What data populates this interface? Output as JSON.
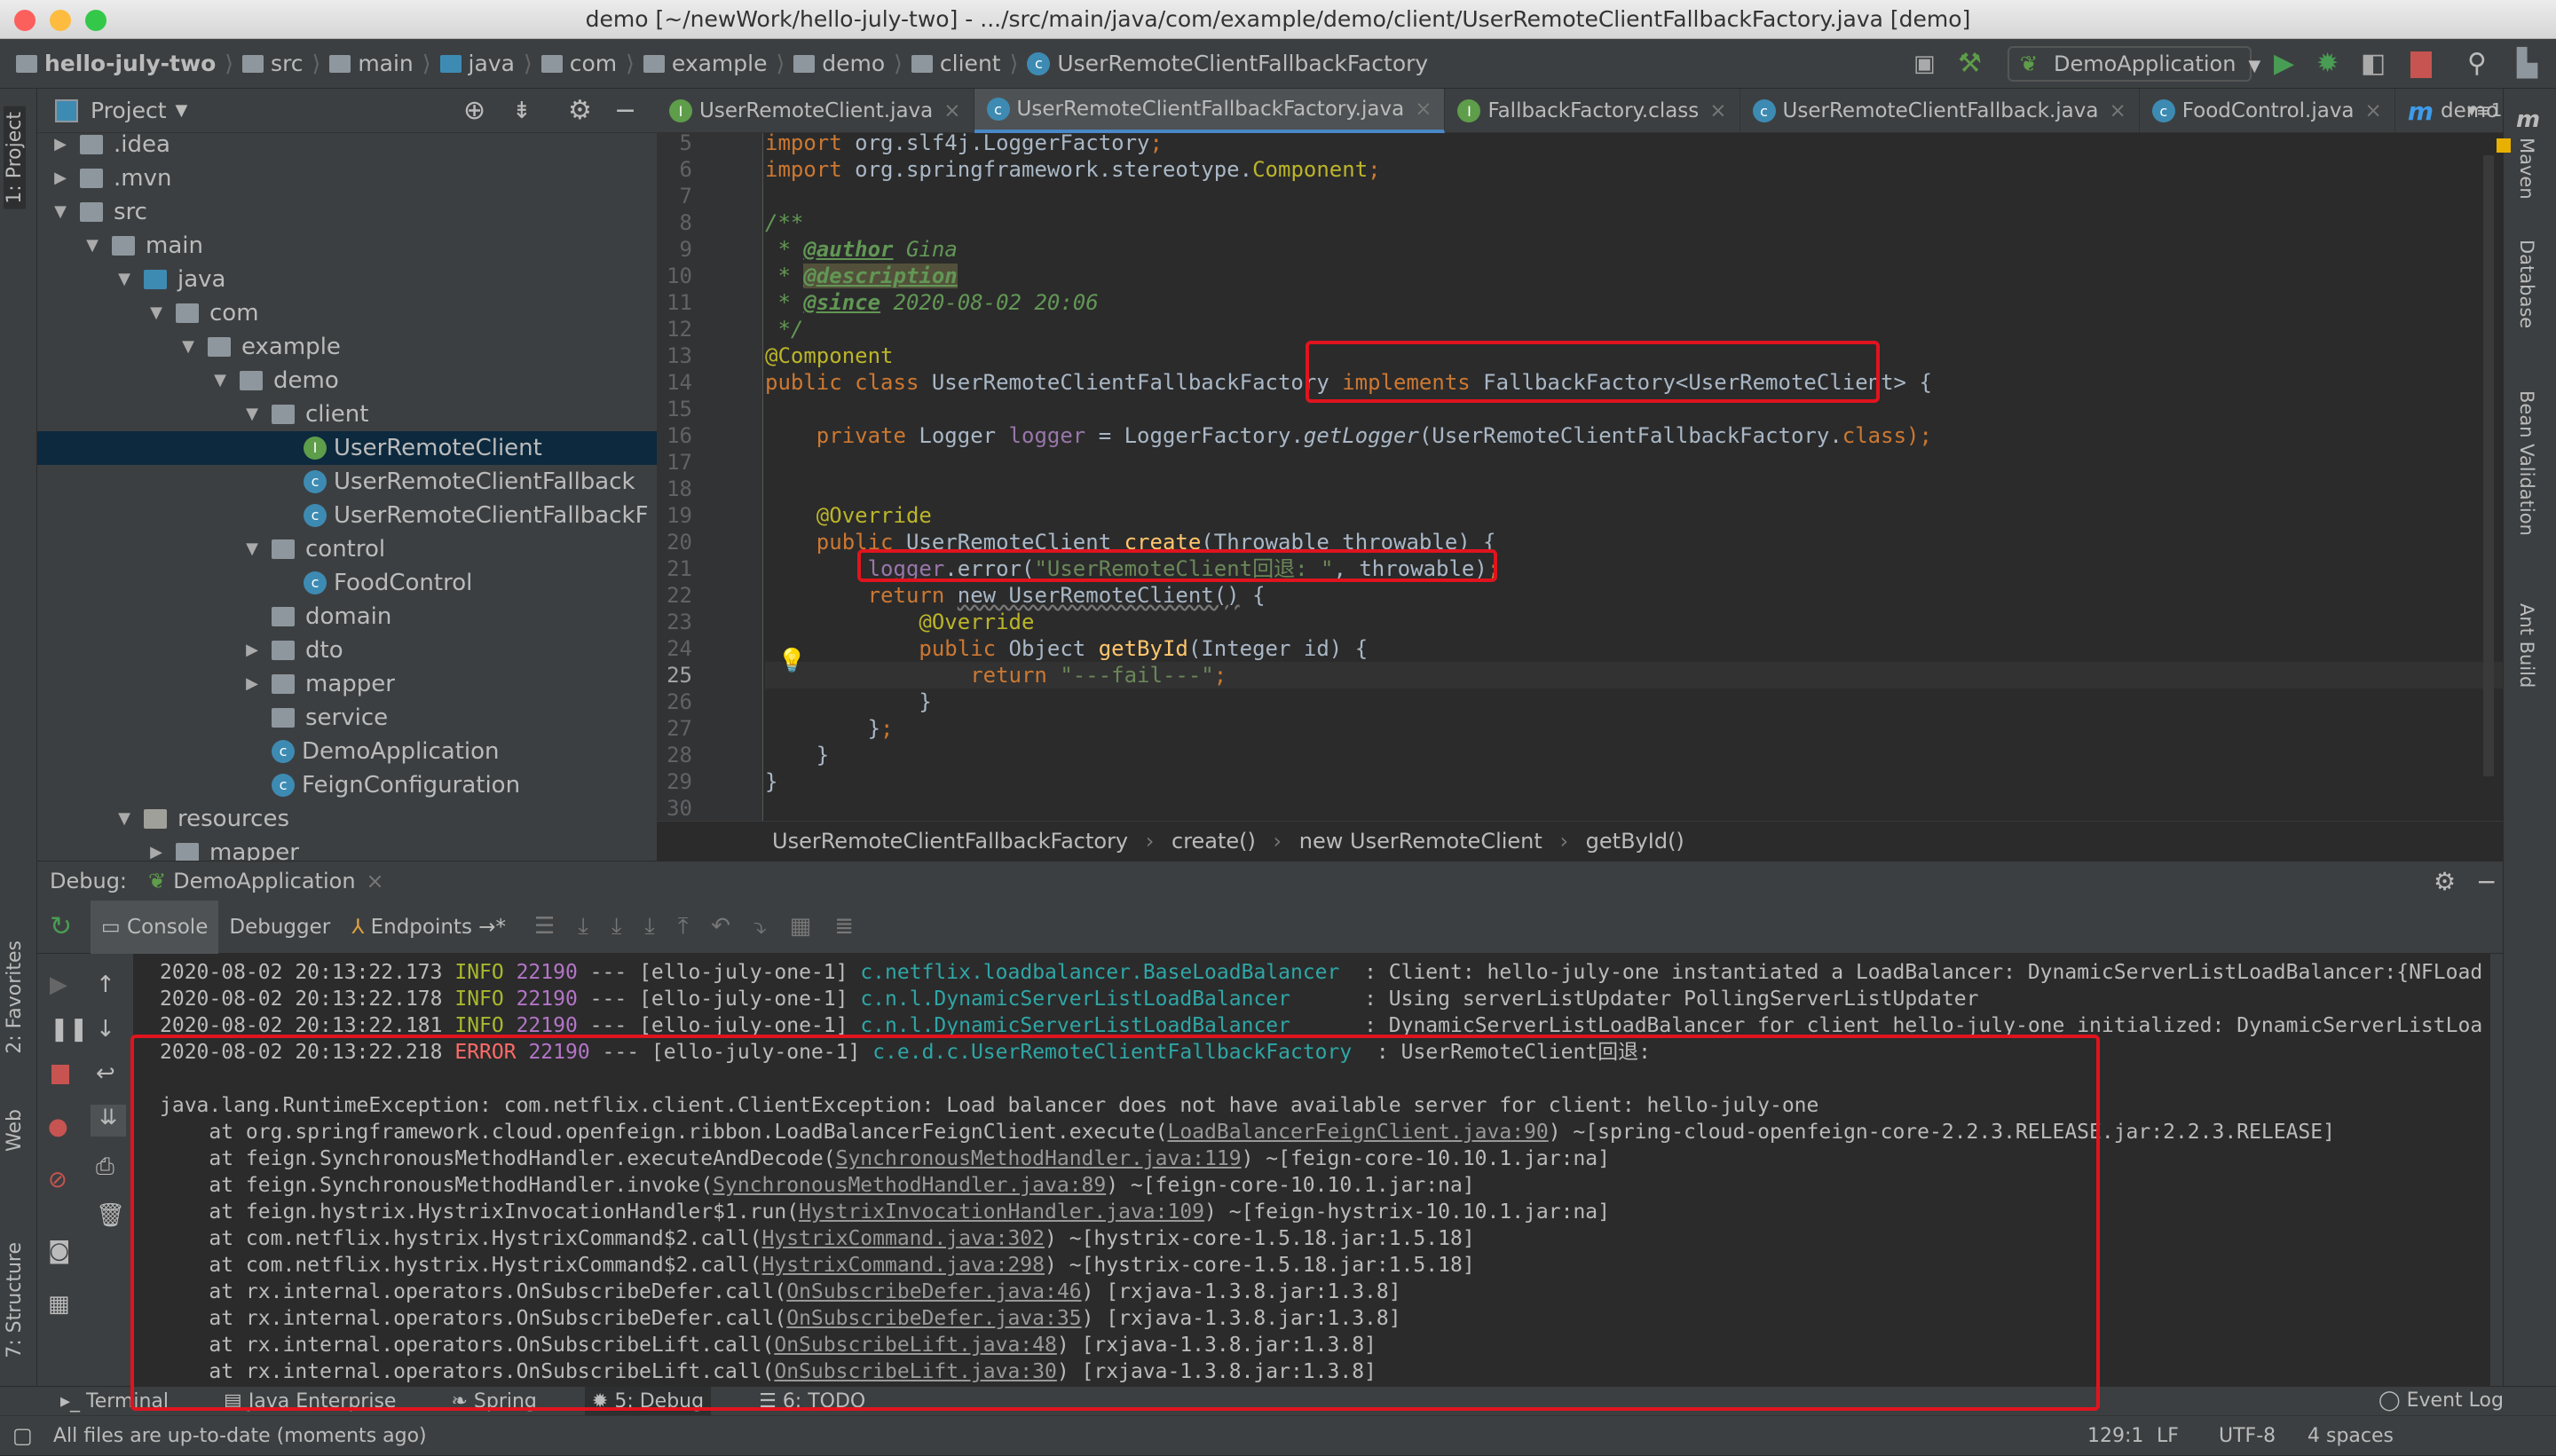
{
  "window": {
    "title": "demo [~/newWork/hello-july-two] - .../src/main/java/com/example/demo/client/UserRemoteClientFallbackFactory.java [demo]"
  },
  "navbar": {
    "crumbs": [
      "hello-july-two",
      "src",
      "main",
      "java",
      "com",
      "example",
      "demo",
      "client"
    ],
    "file": "UserRemoteClientFallbackFactory",
    "run_config": "DemoApplication"
  },
  "project": {
    "header": "Project",
    "tree": [
      {
        "label": ".idea",
        "depth": 1,
        "arrow": "right",
        "icon": "folder"
      },
      {
        "label": ".mvn",
        "depth": 1,
        "arrow": "right",
        "icon": "folder"
      },
      {
        "label": "src",
        "depth": 1,
        "arrow": "down",
        "icon": "folder"
      },
      {
        "label": "main",
        "depth": 2,
        "arrow": "down",
        "icon": "folder"
      },
      {
        "label": "java",
        "depth": 3,
        "arrow": "down",
        "icon": "folder-blue"
      },
      {
        "label": "com",
        "depth": 4,
        "arrow": "down",
        "icon": "package"
      },
      {
        "label": "example",
        "depth": 5,
        "arrow": "down",
        "icon": "package"
      },
      {
        "label": "demo",
        "depth": 6,
        "arrow": "down",
        "icon": "package"
      },
      {
        "label": "client",
        "depth": 7,
        "arrow": "down",
        "icon": "package"
      },
      {
        "label": "UserRemoteClient",
        "depth": 8,
        "arrow": "",
        "icon": "interface",
        "selected": true
      },
      {
        "label": "UserRemoteClientFallback",
        "depth": 8,
        "arrow": "",
        "icon": "class"
      },
      {
        "label": "UserRemoteClientFallbackF",
        "depth": 8,
        "arrow": "",
        "icon": "class"
      },
      {
        "label": "control",
        "depth": 7,
        "arrow": "down",
        "icon": "package"
      },
      {
        "label": "FoodControl",
        "depth": 8,
        "arrow": "",
        "icon": "class"
      },
      {
        "label": "domain",
        "depth": 7,
        "arrow": "",
        "icon": "package"
      },
      {
        "label": "dto",
        "depth": 7,
        "arrow": "right",
        "icon": "package"
      },
      {
        "label": "mapper",
        "depth": 7,
        "arrow": "right",
        "icon": "package"
      },
      {
        "label": "service",
        "depth": 7,
        "arrow": "",
        "icon": "package"
      },
      {
        "label": "DemoApplication",
        "depth": 7,
        "arrow": "",
        "icon": "spring-class"
      },
      {
        "label": "FeignConfiguration",
        "depth": 7,
        "arrow": "",
        "icon": "class"
      },
      {
        "label": "resources",
        "depth": 3,
        "arrow": "down",
        "icon": "folder-res"
      },
      {
        "label": "mapper",
        "depth": 4,
        "arrow": "right",
        "icon": "folder"
      }
    ]
  },
  "editor_tabs": [
    {
      "label": "UserRemoteClient.java",
      "icon": "interface"
    },
    {
      "label": "UserRemoteClientFallbackFactory.java",
      "icon": "class",
      "active": true
    },
    {
      "label": "FallbackFactory.class",
      "icon": "interface"
    },
    {
      "label": "UserRemoteClientFallback.java",
      "icon": "class"
    },
    {
      "label": "FoodControl.java",
      "icon": "class"
    },
    {
      "label": "demo",
      "icon": "maven"
    }
  ],
  "tabs_overflow": "1",
  "right_tools": [
    "Maven",
    "Database",
    "Bean Validation",
    "Ant Build"
  ],
  "left_tools": [
    "1: Project",
    "2: Favorites",
    "Web",
    "7: Structure"
  ],
  "code": {
    "current_line": 25,
    "lines": [
      {
        "n": 5,
        "t": [
          [
            "import ",
            "kw"
          ],
          [
            "org.slf4j.LoggerFactory",
            ""
          ],
          [
            ";",
            "kw"
          ]
        ]
      },
      {
        "n": 6,
        "t": [
          [
            "import ",
            "kw"
          ],
          [
            "org.springframework.stereotype.",
            ""
          ],
          [
            "Component",
            "an"
          ],
          [
            ";",
            "kw"
          ]
        ]
      },
      {
        "n": 7,
        "t": []
      },
      {
        "n": 8,
        "t": [
          [
            "/**",
            "cm"
          ]
        ]
      },
      {
        "n": 9,
        "t": [
          [
            " * ",
            "cm"
          ],
          [
            "@author",
            "tag"
          ],
          [
            " Gina",
            "cm"
          ]
        ]
      },
      {
        "n": 10,
        "t": [
          [
            " * ",
            "cm"
          ],
          [
            "@description",
            "tag hl"
          ]
        ]
      },
      {
        "n": 11,
        "t": [
          [
            " * ",
            "cm"
          ],
          [
            "@since",
            "tag"
          ],
          [
            " 2020-08-02 20:06",
            "cm"
          ]
        ]
      },
      {
        "n": 12,
        "t": [
          [
            " */",
            "cm"
          ]
        ]
      },
      {
        "n": 13,
        "t": [
          [
            "@Component",
            "an"
          ]
        ]
      },
      {
        "n": 14,
        "t": [
          [
            "public class ",
            "kw"
          ],
          [
            "UserRemoteClientFallbackFactory ",
            ""
          ],
          [
            "implements ",
            "kw"
          ],
          [
            "FallbackFactory<UserRemoteClient> {",
            ""
          ]
        ]
      },
      {
        "n": 15,
        "t": []
      },
      {
        "n": 16,
        "t": [
          [
            "    private ",
            "kw"
          ],
          [
            "Logger ",
            ""
          ],
          [
            "logger",
            "fld"
          ],
          [
            " = LoggerFactory.",
            ""
          ],
          [
            "getLogger",
            "it"
          ],
          [
            "(UserRemoteClientFallbackFactory.",
            ""
          ],
          [
            "class",
            "kw"
          ],
          [
            ");",
            "kw"
          ]
        ]
      },
      {
        "n": 17,
        "t": []
      },
      {
        "n": 18,
        "t": []
      },
      {
        "n": 19,
        "t": [
          [
            "    @Override",
            "an"
          ]
        ]
      },
      {
        "n": 20,
        "t": [
          [
            "    public ",
            "kw"
          ],
          [
            "UserRemoteClient ",
            ""
          ],
          [
            "create",
            "fn"
          ],
          [
            "(Throwable throwable) {",
            ""
          ]
        ]
      },
      {
        "n": 21,
        "t": [
          [
            "        ",
            ""
          ],
          [
            "logger",
            "fld"
          ],
          [
            ".error(",
            ""
          ],
          [
            "\"UserRemoteClient回退: \"",
            "st"
          ],
          [
            ", throwable)",
            ""
          ],
          [
            ";",
            "kw"
          ]
        ]
      },
      {
        "n": 22,
        "t": [
          [
            "        return ",
            "kw"
          ],
          [
            "new UserRemoteClient()",
            "wav"
          ],
          [
            " {",
            ""
          ]
        ]
      },
      {
        "n": 23,
        "t": [
          [
            "            @Override",
            "an"
          ]
        ]
      },
      {
        "n": 24,
        "t": [
          [
            "            public ",
            "kw"
          ],
          [
            "Object ",
            ""
          ],
          [
            "getById",
            "fn"
          ],
          [
            "(Integer id) {",
            ""
          ]
        ]
      },
      {
        "n": 25,
        "t": [
          [
            "                return ",
            "kw"
          ],
          [
            "\"---fail---\"",
            "st"
          ],
          [
            ";",
            "kw"
          ]
        ]
      },
      {
        "n": 26,
        "t": [
          [
            "            }",
            ""
          ]
        ]
      },
      {
        "n": 27,
        "t": [
          [
            "        }",
            ""
          ],
          [
            ";",
            "kw"
          ]
        ]
      },
      {
        "n": 28,
        "t": [
          [
            "    }",
            ""
          ]
        ]
      },
      {
        "n": 29,
        "t": [
          [
            "}",
            ""
          ]
        ]
      },
      {
        "n": 30,
        "t": []
      }
    ]
  },
  "editor_breadcrumb": [
    "UserRemoteClientFallbackFactory",
    "create()",
    "new UserRemoteClient",
    "getById()"
  ],
  "debug": {
    "label": "Debug:",
    "session": "DemoApplication",
    "tabs": [
      "Console",
      "Debugger",
      "Endpoints"
    ]
  },
  "console": [
    [
      [
        "2020-08-02 20:13:22.173 ",
        ""
      ],
      [
        "INFO",
        "info"
      ],
      [
        " 22190",
        "pid"
      ],
      [
        " --- [ello-july-one-1] ",
        ""
      ],
      [
        "c.netflix.loadbalancer.BaseLoadBalancer",
        "logger"
      ],
      [
        "  : Client: hello-july-one instantiated a LoadBalancer: DynamicServerListLoadBalancer:{NFLoad",
        ""
      ]
    ],
    [
      [
        "2020-08-02 20:13:22.178 ",
        ""
      ],
      [
        "INFO",
        "info"
      ],
      [
        " 22190",
        "pid"
      ],
      [
        " --- [ello-july-one-1] ",
        ""
      ],
      [
        "c.n.l.DynamicServerListLoadBalancer",
        "logger"
      ],
      [
        "      : Using serverListUpdater PollingServerListUpdater",
        ""
      ]
    ],
    [
      [
        "2020-08-02 20:13:22.181 ",
        ""
      ],
      [
        "INFO",
        "info"
      ],
      [
        " 22190",
        "pid"
      ],
      [
        " --- [ello-july-one-1] ",
        ""
      ],
      [
        "c.n.l.DynamicServerListLoadBalancer",
        "logger"
      ],
      [
        "      : DynamicServerListLoadBalancer for client hello-july-one initialized: DynamicServerListLoa",
        ""
      ]
    ],
    [
      [
        "2020-08-02 20:13:22.218 ",
        ""
      ],
      [
        "ERROR",
        "err"
      ],
      [
        " 22190",
        "pid"
      ],
      [
        " --- [ello-july-one-1] ",
        ""
      ],
      [
        "c.e.d.c.UserRemoteClientFallbackFactory",
        "logger"
      ],
      [
        "  : UserRemoteClient回退:",
        ""
      ]
    ],
    [],
    [
      [
        "java.lang.RuntimeException: com.netflix.client.ClientException: Load balancer does not have available server for client: hello-july-one",
        ""
      ]
    ],
    [
      [
        "    at org.springframework.cloud.openfeign.ribbon.LoadBalancerFeignClient.execute(",
        ""
      ],
      [
        "LoadBalancerFeignClient.java:90",
        "lnk"
      ],
      [
        ") ~[spring-cloud-openfeign-core-2.2.3.RELEASE.jar:2.2.3.RELEASE]",
        ""
      ]
    ],
    [
      [
        "    at feign.SynchronousMethodHandler.executeAndDecode(",
        ""
      ],
      [
        "SynchronousMethodHandler.java:119",
        "lnk"
      ],
      [
        ") ~[feign-core-10.10.1.jar:na]",
        ""
      ]
    ],
    [
      [
        "    at feign.SynchronousMethodHandler.invoke(",
        ""
      ],
      [
        "SynchronousMethodHandler.java:89",
        "lnk"
      ],
      [
        ") ~[feign-core-10.10.1.jar:na]",
        ""
      ]
    ],
    [
      [
        "    at feign.hystrix.HystrixInvocationHandler$1.run(",
        ""
      ],
      [
        "HystrixInvocationHandler.java:109",
        "lnk"
      ],
      [
        ") ~[feign-hystrix-10.10.1.jar:na]",
        ""
      ]
    ],
    [
      [
        "    at com.netflix.hystrix.HystrixCommand$2.call(",
        ""
      ],
      [
        "HystrixCommand.java:302",
        "lnk"
      ],
      [
        ") ~[hystrix-core-1.5.18.jar:1.5.18]",
        ""
      ]
    ],
    [
      [
        "    at com.netflix.hystrix.HystrixCommand$2.call(",
        ""
      ],
      [
        "HystrixCommand.java:298",
        "lnk"
      ],
      [
        ") ~[hystrix-core-1.5.18.jar:1.5.18]",
        ""
      ]
    ],
    [
      [
        "    at rx.internal.operators.OnSubscribeDefer.call(",
        ""
      ],
      [
        "OnSubscribeDefer.java:46",
        "lnk"
      ],
      [
        ") [rxjava-1.3.8.jar:1.3.8]",
        ""
      ]
    ],
    [
      [
        "    at rx.internal.operators.OnSubscribeDefer.call(",
        ""
      ],
      [
        "OnSubscribeDefer.java:35",
        "lnk"
      ],
      [
        ") [rxjava-1.3.8.jar:1.3.8]",
        ""
      ]
    ],
    [
      [
        "    at rx.internal.operators.OnSubscribeLift.call(",
        ""
      ],
      [
        "OnSubscribeLift.java:48",
        "lnk"
      ],
      [
        ") [rxjava-1.3.8.jar:1.3.8]",
        ""
      ]
    ],
    [
      [
        "    at rx.internal.operators.OnSubscribeLift.call(",
        ""
      ],
      [
        "OnSubscribeLift.java:30",
        "lnk"
      ],
      [
        ") [rxjava-1.3.8.jar:1.3.8]",
        ""
      ]
    ]
  ],
  "bottom_tabs": [
    {
      "label": "Terminal"
    },
    {
      "label": "Java Enterprise"
    },
    {
      "label": "Spring"
    },
    {
      "label": "5: Debug",
      "active": true
    },
    {
      "label": "6: TODO"
    }
  ],
  "event_log": "Event Log",
  "status": {
    "message": "All files are up-to-date (moments ago)",
    "position": "129:1",
    "line_sep": "LF",
    "encoding": "UTF-8",
    "indent": "4 spaces"
  },
  "colors": {
    "accent": "#4a88c7",
    "highlight_box": "#e0141e",
    "error": "#ff6b68",
    "info": "#a9b82e"
  }
}
